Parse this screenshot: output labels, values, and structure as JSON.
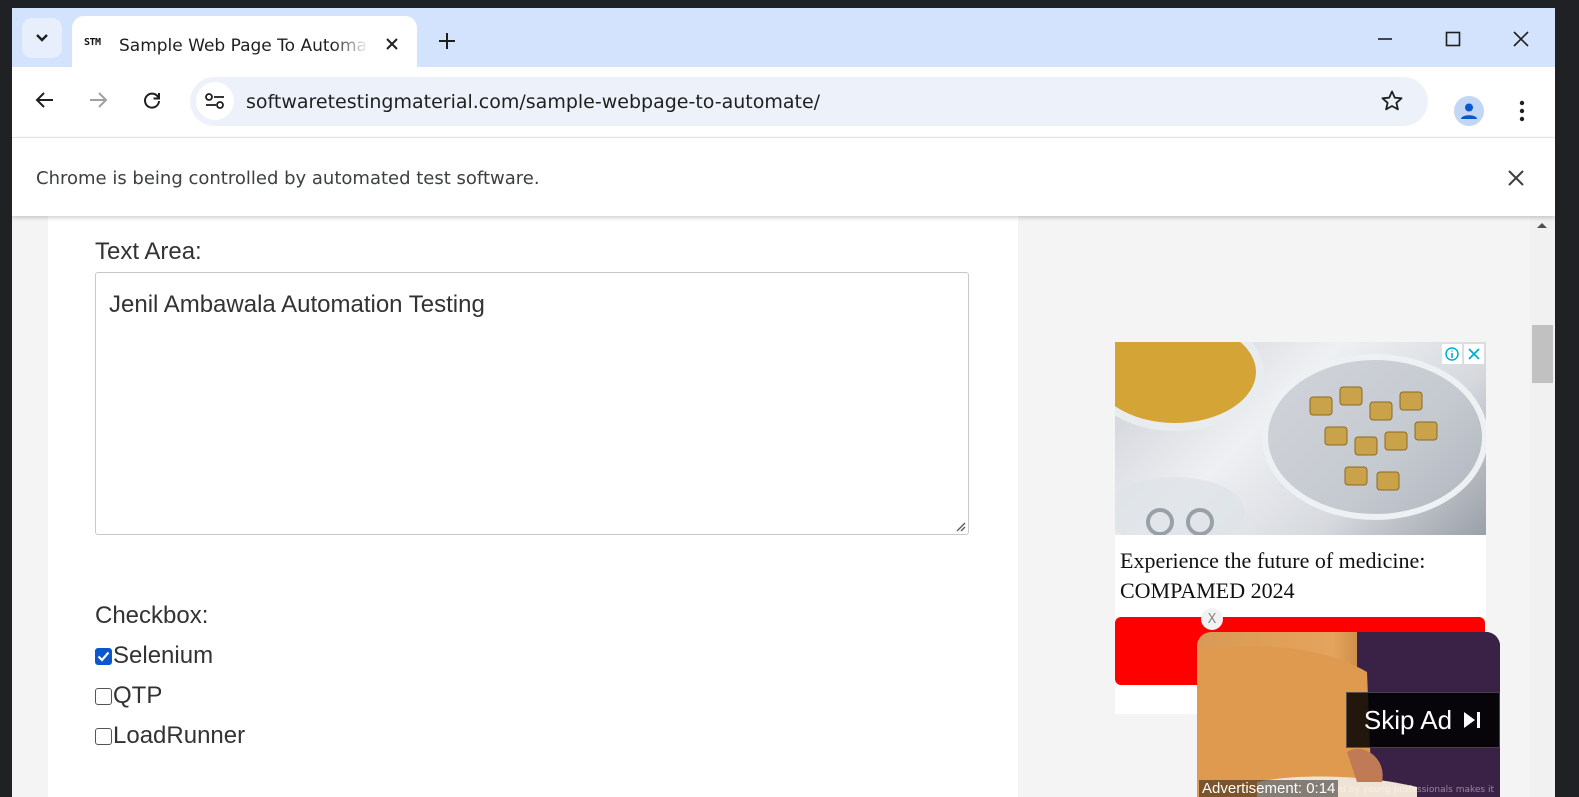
{
  "browser": {
    "tab_title": "Sample Web Page To Automate",
    "favicon_text": "STM",
    "url": "softwaretestingmaterial.com/sample-webpage-to-automate/",
    "infobar_text": "Chrome is being controlled by automated test software."
  },
  "page": {
    "textarea_label": "Text Area:",
    "textarea_value": "Jenil Ambawala Automation Testing",
    "checkbox_label": "Checkbox:",
    "checkboxes": [
      {
        "label": "Selenium",
        "checked": true
      },
      {
        "label": "QTP",
        "checked": false
      },
      {
        "label": "LoadRunner",
        "checked": false
      }
    ]
  },
  "ad": {
    "headline": "Experience the future of medicine: COMPAMED 2024",
    "cta_color": "#ff0000"
  },
  "video_ad": {
    "close_label": "X",
    "skip_label": "Skip Ad",
    "timer_text": "Advertisement: 0:14",
    "fine_print": "ded by young professionals makes it"
  },
  "colors": {
    "tabstrip": "#d3e3fd",
    "omnibox": "#edf2fa",
    "checkbox_accent": "#0b57d0"
  }
}
